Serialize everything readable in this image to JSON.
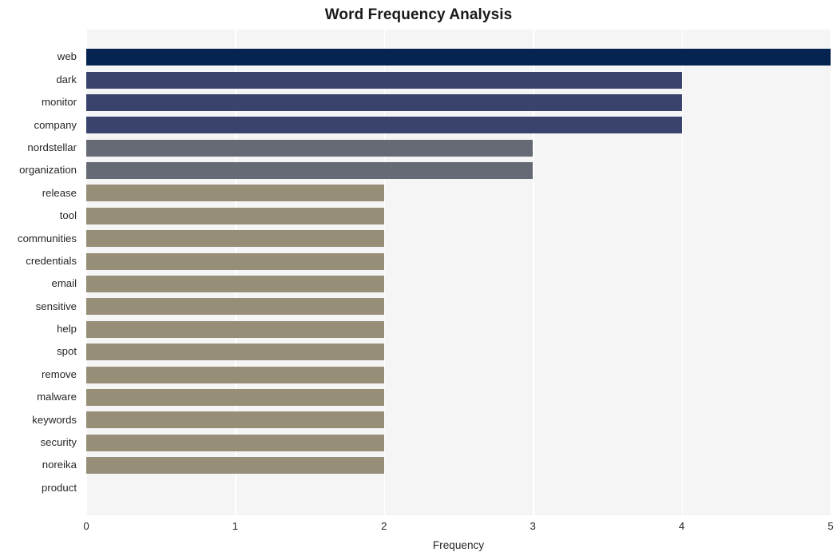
{
  "chart_data": {
    "type": "bar",
    "orientation": "horizontal",
    "title": "Word Frequency Analysis",
    "xlabel": "Frequency",
    "ylabel": "",
    "categories": [
      "web",
      "dark",
      "monitor",
      "company",
      "nordstellar",
      "organization",
      "release",
      "tool",
      "communities",
      "credentials",
      "email",
      "sensitive",
      "help",
      "spot",
      "remove",
      "malware",
      "keywords",
      "security",
      "noreika",
      "product"
    ],
    "values": [
      5,
      4,
      4,
      4,
      3,
      3,
      2,
      2,
      2,
      2,
      2,
      2,
      2,
      2,
      2,
      2,
      2,
      2,
      2
    ],
    "bar_colors": [
      "#05244f",
      "#39436c",
      "#39436c",
      "#39436c",
      "#656a74",
      "#656a74",
      "#968e77",
      "#968e77",
      "#968e77",
      "#968e77",
      "#968e77",
      "#968e77",
      "#968e77",
      "#968e77",
      "#968e77",
      "#968e77",
      "#968e77",
      "#968e77",
      "#968e77"
    ],
    "xlim": [
      0,
      5
    ],
    "xticks": [
      0,
      1,
      2,
      3,
      4,
      5
    ],
    "xtick_labels": [
      "0",
      "1",
      "2",
      "3",
      "4",
      "5"
    ],
    "grid": true,
    "grid_color": "#ffffff",
    "plot_background": "#f5f5f6",
    "figure_background": "#ffffff",
    "legend": null
  }
}
